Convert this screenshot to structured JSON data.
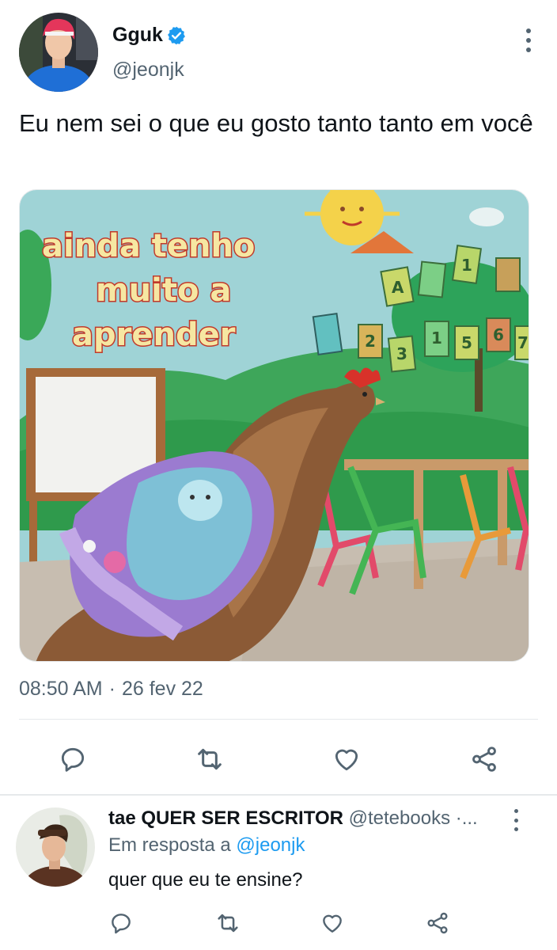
{
  "tweet": {
    "author": {
      "display_name": "Gguk",
      "handle": "@jeonjk",
      "verified": true,
      "avatar_icon": "avatar-photo"
    },
    "text": "Eu nem sei o que eu gosto tanto tanto em você",
    "media": {
      "caption_lines": [
        "ainda tenho",
        "muito a",
        "aprender"
      ],
      "classroom_letters": [
        "A",
        "1",
        "3",
        "2",
        "3",
        "1",
        "5",
        "6",
        "7"
      ]
    },
    "time": "08:50 AM",
    "separator": "·",
    "date": "26 fev 22",
    "actions": {
      "reply_icon": "reply-icon",
      "retweet_icon": "retweet-icon",
      "like_icon": "like-icon",
      "share_icon": "share-icon"
    }
  },
  "reply": {
    "display_name": "tae QUER SER ESCRITOR",
    "handle": "@tetebooks ·...",
    "in_reply_prefix": "Em resposta a",
    "in_reply_mention": "@jeonjk",
    "text": "quer que eu te ensine?"
  },
  "colors": {
    "accent": "#1d9bf0",
    "text_primary": "#0f1419",
    "text_secondary": "#536471",
    "divider": "#e6e9eb"
  }
}
